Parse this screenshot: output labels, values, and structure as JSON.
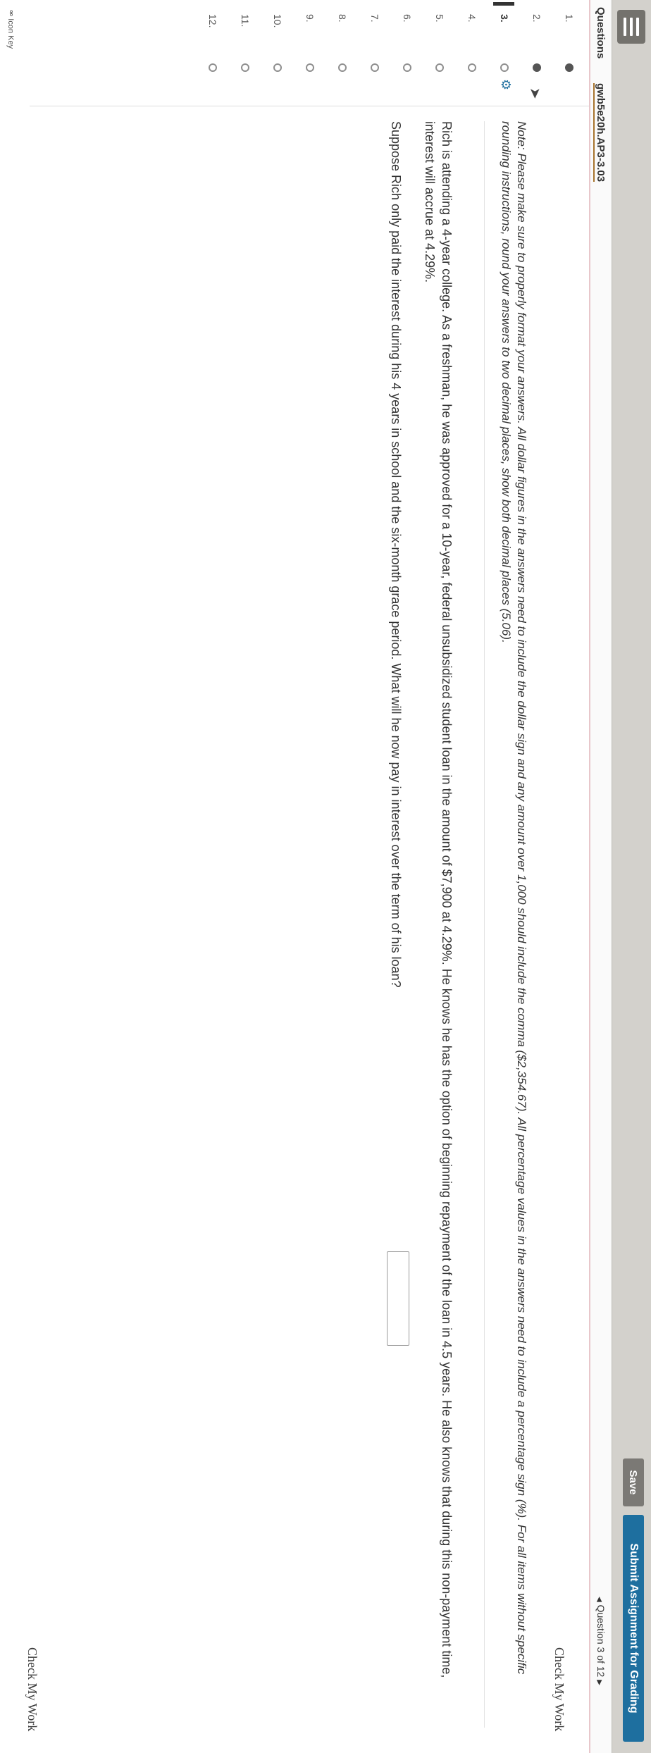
{
  "header": {
    "save_label": "Save",
    "submit_label": "Submit Assignment for Grading"
  },
  "subheader": {
    "questions_label": "Questions",
    "assignment_code": "gwb5e20h.AP3-3.03",
    "question_position": "Question 3 of 12"
  },
  "sidebar": {
    "items": [
      {
        "num": "1.",
        "status": "answered"
      },
      {
        "num": "2.",
        "status": "answered"
      },
      {
        "num": "3.",
        "status": "unanswered",
        "current": true
      },
      {
        "num": "4.",
        "status": "unanswered"
      },
      {
        "num": "5.",
        "status": "unanswered"
      },
      {
        "num": "6.",
        "status": "unanswered"
      },
      {
        "num": "7.",
        "status": "unanswered"
      },
      {
        "num": "8.",
        "status": "unanswered"
      },
      {
        "num": "9.",
        "status": "unanswered"
      },
      {
        "num": "10.",
        "status": "unanswered"
      },
      {
        "num": "11.",
        "status": "unanswered"
      },
      {
        "num": "12.",
        "status": "unanswered"
      }
    ],
    "icon_key_label": "Icon Key"
  },
  "main": {
    "check_label": "Check My Work",
    "note": "Note: Please make sure to properly format your answers. All dollar figures in the answers need to include the dollar sign and any amount over 1,000 should include the comma ($2,354.67). All percentage values in the answers need to include a percentage sign (%). For all items without specific rounding instructions, round your answers to two decimal places, show both decimal places (5.06).",
    "paragraph": "Rich is attending a 4-year college. As a freshman, he was approved for a 10-year, federal unsubsidized student loan in the amount of $7,900 at 4.29%. He knows he has the option of beginning repayment of the loan in 4.5 years. He also knows that during this non-payment time, interest will accrue at 4.29%.",
    "question": "Suppose Rich only paid the interest during his 4 years in school and the six-month grace period. What will he now pay in interest over the term of his loan?",
    "answer_value": ""
  },
  "colors": {
    "submit_button": "#1e6f9f",
    "save_button": "#7b7975",
    "appbar": "#d3d1cc",
    "accent_underline": "#a8742e"
  }
}
